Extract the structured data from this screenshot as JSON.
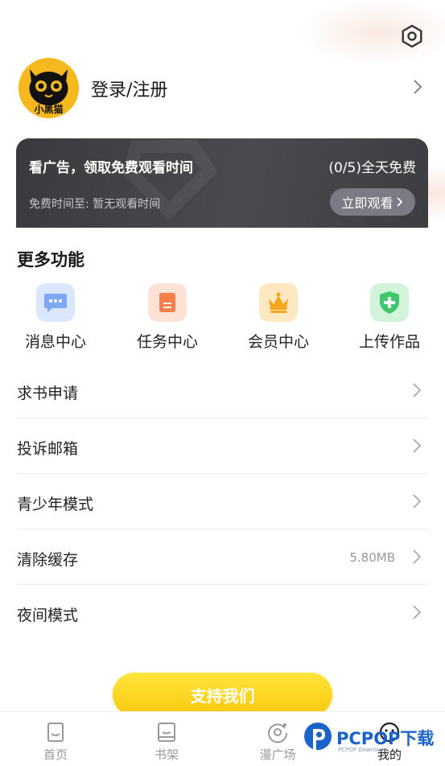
{
  "header": {
    "settings_icon": "gear-icon"
  },
  "profile": {
    "avatar_text": "小黑猫",
    "login_label": "登录/注册"
  },
  "ad_banner": {
    "title": "看广告，领取免费观看时间",
    "count": "(0/5)全天免费",
    "free_time": "免费时间至: 暂无观看时间",
    "watch_button": "立即观看"
  },
  "more_functions": {
    "title": "更多功能",
    "items": [
      {
        "label": "消息中心",
        "icon": "message-icon",
        "color": "#a9c6f7"
      },
      {
        "label": "任务中心",
        "icon": "task-icon",
        "color": "#f9c7ab"
      },
      {
        "label": "会员中心",
        "icon": "crown-icon",
        "color": "#fbd38a"
      },
      {
        "label": "上传作品",
        "icon": "upload-shield-icon",
        "color": "#9fe0b0"
      }
    ]
  },
  "menu": [
    {
      "label": "求书申请",
      "value": ""
    },
    {
      "label": "投诉邮箱",
      "value": ""
    },
    {
      "label": "青少年模式",
      "value": ""
    },
    {
      "label": "清除缓存",
      "value": "5.80MB"
    },
    {
      "label": "夜间模式",
      "value": ""
    }
  ],
  "support_button": "支持我们",
  "tabbar": {
    "tabs": [
      {
        "label": "首页",
        "icon": "home-icon"
      },
      {
        "label": "书架",
        "icon": "bookshelf-icon"
      },
      {
        "label": "漫广场",
        "icon": "plaza-icon"
      },
      {
        "label": "我的",
        "icon": "profile-icon"
      }
    ],
    "active": "我的"
  },
  "watermark": {
    "brand": "PCPOP下载",
    "sub": "PCPOP Download"
  },
  "colors": {
    "accent_yellow": "#f9c80e",
    "banner_dark": "#3a3a3e",
    "watermark_blue": "#1a63c9"
  }
}
